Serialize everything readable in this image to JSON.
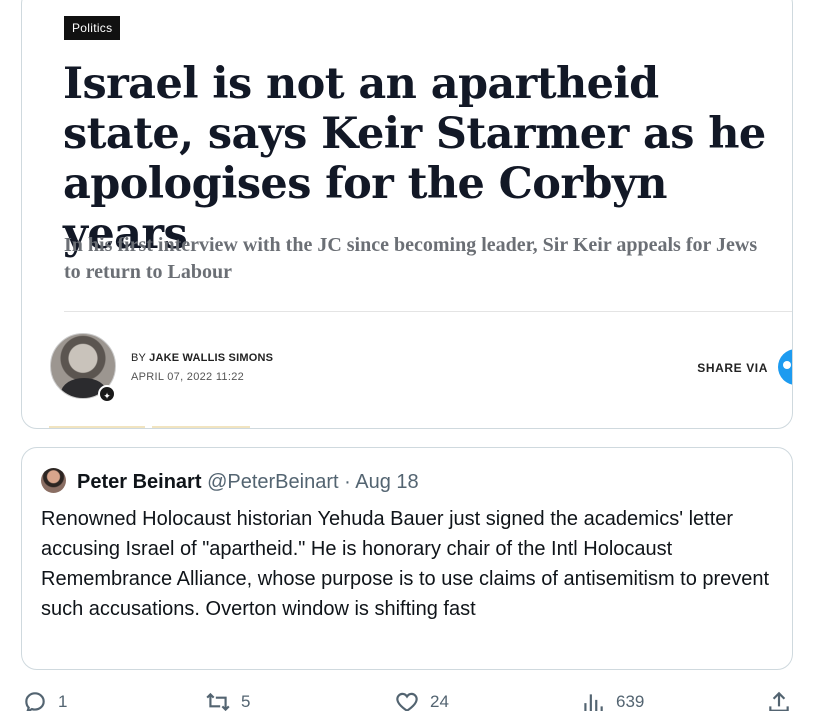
{
  "article": {
    "category": "Politics",
    "headline": "Israel is not an apartheid state, says Keir Starmer as he apologises for the Corbyn years",
    "standfirst": "In his first interview with the JC since becoming leader, Sir Keir appeals for Jews to return to Labour",
    "byline_prefix": "BY",
    "author": "JAKE WALLIS SIMONS",
    "date": "APRIL 07, 2022 11:22",
    "share_label": "SHARE VIA"
  },
  "quoted_tweet": {
    "display_name": "Peter Beinart",
    "handle": "@PeterBeinart",
    "separator": "·",
    "date": "Aug 18",
    "text": "Renowned Holocaust historian Yehuda Bauer just signed the academics' letter accusing Israel of \"apartheid.\" He is honorary chair of the Intl Holocaust Remembrance Alliance, whose purpose is to use claims of antisemitism to prevent such accusations. Overton window is shifting fast"
  },
  "actions": {
    "replies": "1",
    "retweets": "5",
    "likes": "24",
    "views": "639"
  },
  "colors": {
    "border": "#cfd9de",
    "secondary_text": "#536471",
    "primary_text": "#0f1419",
    "headline": "#121826",
    "twitter_blue": "#1d9bf0"
  }
}
